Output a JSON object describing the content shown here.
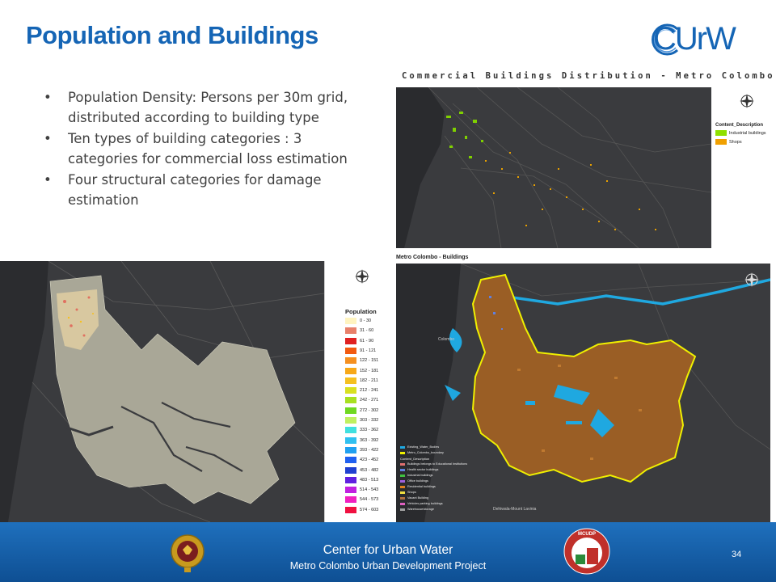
{
  "slide": {
    "title": "Population and Buildings",
    "logo_text": "CUrW",
    "bullets": [
      "Population Density: Persons per 30m grid, distributed according to building type",
      "Ten types of building categories : 3 categories for commercial loss estimation",
      "Four structural categories for damage estimation"
    ],
    "bullet_symbol": "•"
  },
  "commercial_map": {
    "title": "Commercial Buildings Distribution - Metro Colombo",
    "legend_title": "Content_Description",
    "legend": [
      {
        "label": "Industrial buildings",
        "color": "#8fe000"
      },
      {
        "label": "Shops",
        "color": "#f0a000"
      }
    ]
  },
  "population_map": {
    "legend_title": "Population",
    "legend": [
      {
        "label": "0 - 30",
        "color": "#fff4c0"
      },
      {
        "label": "31 - 60",
        "color": "#e8806a"
      },
      {
        "label": "61 - 90",
        "color": "#e02020"
      },
      {
        "label": "91 - 121",
        "color": "#f25a10"
      },
      {
        "label": "122 - 151",
        "color": "#f59020"
      },
      {
        "label": "152 - 181",
        "color": "#f7a818"
      },
      {
        "label": "182 - 211",
        "color": "#f5c020"
      },
      {
        "label": "212 - 241",
        "color": "#d8e020"
      },
      {
        "label": "242 - 271",
        "color": "#a8e020"
      },
      {
        "label": "272 - 302",
        "color": "#70d820"
      },
      {
        "label": "303 - 332",
        "color": "#c0f060"
      },
      {
        "label": "333 - 362",
        "color": "#40e0e0"
      },
      {
        "label": "363 - 392",
        "color": "#30c0f0"
      },
      {
        "label": "393 - 422",
        "color": "#20a0f0"
      },
      {
        "label": "423 - 452",
        "color": "#2060f0"
      },
      {
        "label": "453 - 482",
        "color": "#2040d0"
      },
      {
        "label": "483 - 513",
        "color": "#6020e0"
      },
      {
        "label": "514 - 543",
        "color": "#c020e0"
      },
      {
        "label": "544 - 573",
        "color": "#f020c0"
      },
      {
        "label": "574 - 603",
        "color": "#f01040"
      }
    ]
  },
  "buildings_map": {
    "title": "Metro Colombo - Buildings",
    "legend_top": [
      {
        "label": "Existing_Water_Bodies",
        "color": "#1fa8e0"
      },
      {
        "label": "Metro_Colombo_boundary",
        "color": "#f0f000"
      }
    ],
    "legend_heading": "Content_Description",
    "legend": [
      {
        "label": "Buildings belongs to Educational Institutions",
        "color": "#e07070"
      },
      {
        "label": "Health sector buildings",
        "color": "#6080e0"
      },
      {
        "label": "Industrial buildings",
        "color": "#40c040"
      },
      {
        "label": "Office buildings",
        "color": "#a060e0"
      },
      {
        "label": "Residential buildings",
        "color": "#e08020"
      },
      {
        "label": "Shops",
        "color": "#f0e040"
      },
      {
        "label": "Vacant Building",
        "color": "#b07040"
      },
      {
        "label": "Vehicles parking buildings",
        "color": "#e060c0"
      },
      {
        "label": "Warehouse/storage",
        "color": "#a0a0a0"
      }
    ],
    "place_labels": [
      "Colombo",
      "Dehiwala-Mount Lavinia"
    ]
  },
  "footer": {
    "line1": "Center for Urban Water",
    "line2": "Metro Colombo Urban Development Project",
    "page": "34",
    "mcudp_text": "MCUDP"
  },
  "colors": {
    "title_blue": "#1565b5",
    "footer_blue": "#1565b5",
    "map_bg": "#3a3b3e"
  }
}
